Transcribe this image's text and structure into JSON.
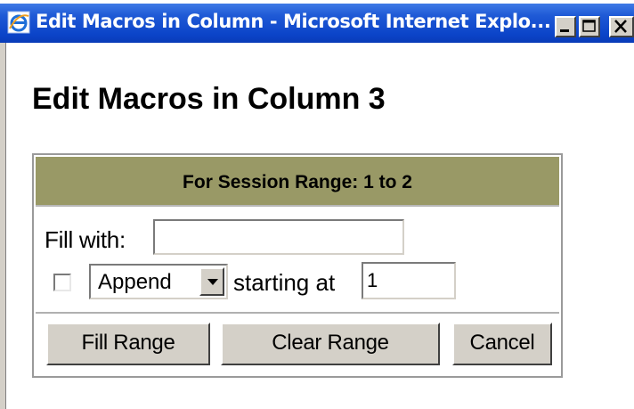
{
  "window": {
    "title": "Edit Macros in Column - Microsoft Internet Explo...",
    "icon": "internet-explorer-icon",
    "controls": [
      "minimize-icon",
      "maximize-icon",
      "close-icon"
    ]
  },
  "page": {
    "title": "Edit Macros in Column 3"
  },
  "panel": {
    "header": "For Session Range: 1 to 2",
    "header_color": "#999966",
    "fill_label": "Fill with:",
    "fill_value": "",
    "checkbox_checked": false,
    "mode_selected": "Append",
    "starting_label": "starting at",
    "starting_value": "1"
  },
  "buttons": {
    "fill_range": "Fill Range",
    "clear_range": "Clear Range",
    "cancel": "Cancel"
  },
  "colors": {
    "titlebar": "#0b43c8",
    "button_face": "#d4d0c8"
  }
}
